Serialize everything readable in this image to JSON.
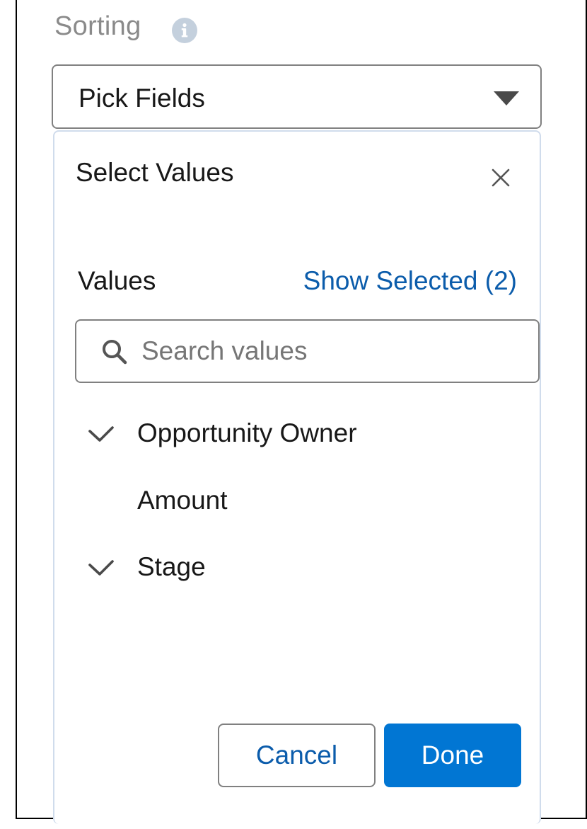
{
  "sorting": {
    "label": "Sorting",
    "info_icon": "info-icon"
  },
  "picker": {
    "label": "Pick Fields",
    "caret_icon": "caret-down-icon"
  },
  "popover": {
    "title": "Select Values",
    "close_icon": "close-icon",
    "values_label": "Values",
    "show_selected": "Show Selected (2)",
    "search": {
      "placeholder": "Search values",
      "value": "",
      "icon": "search-icon"
    },
    "options": [
      {
        "label": "Opportunity Owner",
        "selected": true
      },
      {
        "label": "Amount",
        "selected": false
      },
      {
        "label": "Stage",
        "selected": true
      }
    ],
    "cancel_label": "Cancel",
    "done_label": "Done"
  },
  "colors": {
    "brand": "#0176d3",
    "link": "#0b5cab",
    "border": "#808080",
    "info_icon_bg": "#c4d0dd"
  }
}
